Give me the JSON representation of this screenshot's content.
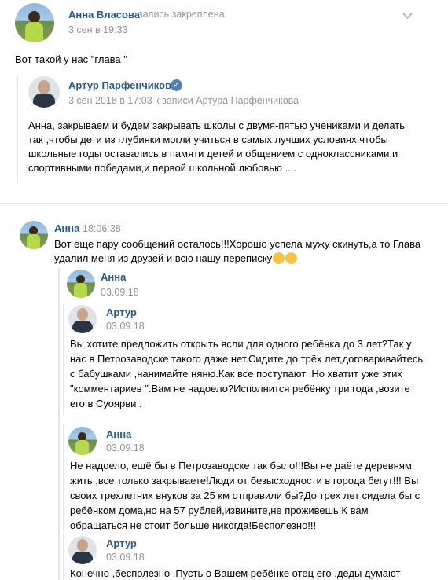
{
  "post": {
    "author": "Анна Власова",
    "pinned": "запись закреплена",
    "date": "3 сен в 19:33",
    "text": "Вот такой у нас \"глава \"",
    "repost": {
      "author": "Артур Парфенчиков",
      "meta": "3 сен 2018 в 17:03 к записи Артура Парфенчикова",
      "text": "Анна, закрываем и будем закрывать школы с двумя-пятью учениками и делать так ,чтобы дети из глубинки могли учиться в самых лучших условиях,чтобы школьные годы оставались в памяти детей и общением с одноклассниками,и спортивными победами,и первой школьной любовью ...."
    }
  },
  "message": {
    "author": "Анна",
    "time": "18:06:38",
    "text": "Вот еще пару сообщений осталось!!!Хорошо успела мужу скинуть,а то Глава удалил меня из друзей и всю нашу переписку",
    "emoji": [
      "blush-emoji",
      "flushed-emoji"
    ]
  },
  "forwards": [
    {
      "author": "Анна",
      "date": "03.09.18"
    },
    {
      "author": "Артур",
      "date": "03.09.18",
      "text": "Вы хотите предложить открыть ясли для одного ребёнка до 3 лет?Так у нас в Петрозаводске такого даже нет.Сидите до трёх лет,договаривайтесь с бабушками ,нанимайте няню.Как все поступают .Но хватит уже этих \"комментариев \".Вам не надоело?Исполнится ребёнку три года ,возите его в Суоярви ."
    },
    {
      "author": "Анна",
      "date": "03.09.18",
      "text": "Не надоело, ещё бы в Петрозаводске так было!!!Вы не даёте деревням жить ,все только закрываете!Люди от безысходности в города бегут!!! Вы своих трехлетних внуков за 25 км отправили бы?До трех лет сидела бы с ребёнком дома,но на 57 рублей,извините,не проживешь!К вам обращаться не стоит больше никогда!Бесполезно!!!"
    },
    {
      "author": "Артур",
      "date": "03.09.18",
      "text": "Конечно ,бесполезно .Пусть о Вашем ребёнке отец его ,деды думают"
    }
  ]
}
